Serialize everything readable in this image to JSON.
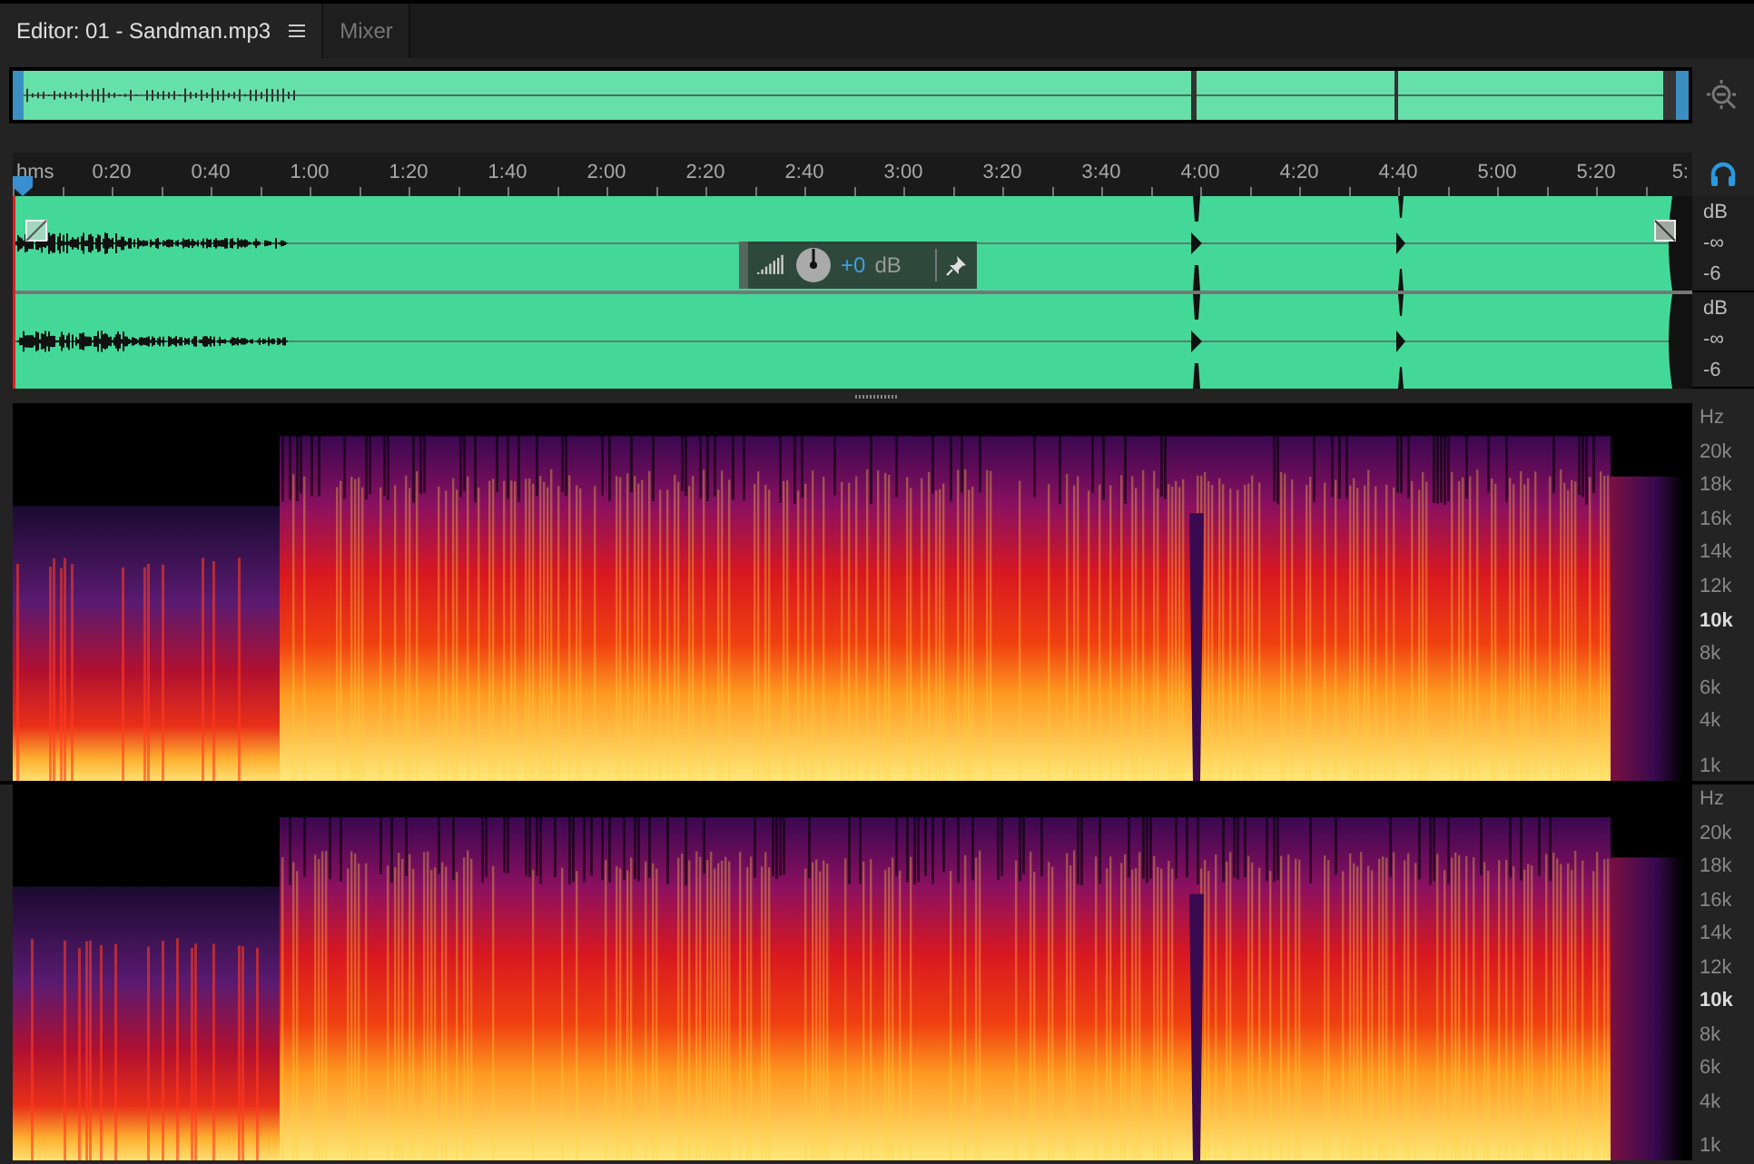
{
  "tabs": [
    {
      "label": "Editor: 01 - Sandman.mp3",
      "selected": true,
      "menu": true
    },
    {
      "label": "Mixer",
      "selected": false,
      "menu": false
    }
  ],
  "ruler": {
    "labels": [
      "hms",
      "0:20",
      "0:40",
      "1:00",
      "1:20",
      "1:40",
      "2:00",
      "2:20",
      "2:40",
      "3:00",
      "3:20",
      "3:40",
      "4:00",
      "4:20",
      "4:40",
      "5:00",
      "5:20",
      "5:"
    ]
  },
  "waveform": {
    "hud": {
      "gain": "+0",
      "unit": "dB"
    },
    "channels": [
      {
        "scale": [
          "dB",
          "-∞",
          "-6"
        ]
      },
      {
        "scale": [
          "dB",
          "-∞",
          "-6"
        ]
      }
    ]
  },
  "spectrogram": {
    "channels": [
      {
        "scale": [
          {
            "label": "Hz",
            "bold": false
          },
          {
            "label": "20k",
            "bold": false
          },
          {
            "label": "18k",
            "bold": false
          },
          {
            "label": "16k",
            "bold": false
          },
          {
            "label": "14k",
            "bold": false
          },
          {
            "label": "12k",
            "bold": false
          },
          {
            "label": "10k",
            "bold": true
          },
          {
            "label": "8k",
            "bold": false
          },
          {
            "label": "6k",
            "bold": false
          },
          {
            "label": "4k",
            "bold": false
          },
          {
            "label": "1k",
            "bold": false
          }
        ]
      },
      {
        "scale": [
          {
            "label": "Hz",
            "bold": false
          },
          {
            "label": "20k",
            "bold": false
          },
          {
            "label": "18k",
            "bold": false
          },
          {
            "label": "16k",
            "bold": false
          },
          {
            "label": "14k",
            "bold": false
          },
          {
            "label": "12k",
            "bold": false
          },
          {
            "label": "10k",
            "bold": true
          },
          {
            "label": "8k",
            "bold": false
          },
          {
            "label": "6k",
            "bold": false
          },
          {
            "label": "4k",
            "bold": false
          },
          {
            "label": "1k",
            "bold": false
          }
        ]
      }
    ]
  }
}
